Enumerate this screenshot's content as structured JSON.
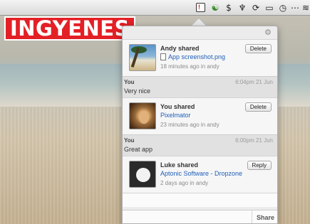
{
  "banner": {
    "label": "INGYENES",
    "color": "#e32026"
  },
  "menubar": {
    "icons": [
      {
        "name": "notification-icon",
        "glyph": "!"
      },
      {
        "name": "sync-icon",
        "glyph": "☯"
      },
      {
        "name": "dollar-icon",
        "glyph": "$"
      },
      {
        "name": "bluetooth-icon",
        "glyph": "♆"
      },
      {
        "name": "refresh-icon",
        "glyph": "⟳"
      },
      {
        "name": "battery-icon",
        "glyph": "▭"
      },
      {
        "name": "clock-icon",
        "glyph": "◷"
      },
      {
        "name": "more-icon",
        "glyph": "⋯"
      },
      {
        "name": "wifi-icon",
        "glyph": "≋"
      }
    ]
  },
  "popup": {
    "settings_icon": "⚙",
    "items": [
      {
        "type": "shared",
        "title": "Andy shared",
        "file": "App screenshot.png",
        "meta": "18 minutes ago in andy",
        "button": "Delete",
        "thumb": "beach"
      },
      {
        "type": "comment",
        "author": "You",
        "time": "6:04pm 21 Jun",
        "text": "Very nice"
      },
      {
        "type": "shared",
        "title": "You shared",
        "file": "Pixelmator",
        "meta": "23 minutes ago in andy",
        "button": "Delete",
        "thumb": "lion"
      },
      {
        "type": "comment",
        "author": "You",
        "time": "6:00pm 21 Jun",
        "text": "Great app"
      },
      {
        "type": "shared",
        "title": "Luke shared",
        "file": "Aptonic Software - Dropzone",
        "meta": "2 days ago in andy",
        "button": "Reply",
        "thumb": "apple"
      }
    ],
    "share_label": "Share"
  }
}
